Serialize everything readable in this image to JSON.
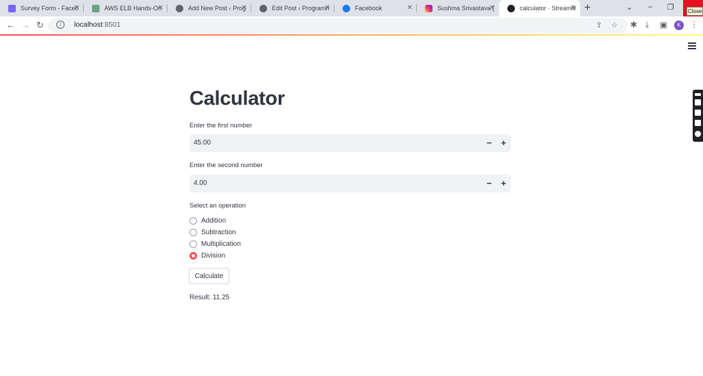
{
  "browser": {
    "tabs": [
      {
        "title": "Survey Form - Faceb",
        "favicon_color": "#7b61ff"
      },
      {
        "title": "AWS ELB Hands-On",
        "favicon_color": "#6aa38a"
      },
      {
        "title": "Add New Post ‹ Prog",
        "favicon_color": "#5f6368"
      },
      {
        "title": "Edit Post ‹ Programm",
        "favicon_color": "#5f6368"
      },
      {
        "title": "Facebook",
        "favicon_color": "#1877f2"
      },
      {
        "title": "Sushma Srivastava (",
        "favicon_color": "#e1306c"
      },
      {
        "title": "calculator · Streamlit",
        "favicon_color": "#202124"
      }
    ],
    "close_tooltip": "Close",
    "url_host": "localhost",
    "url_port": ":8501",
    "avatar_letter": "K"
  },
  "app": {
    "title": "Calculator",
    "first": {
      "label": "Enter the first number",
      "value": "45.00"
    },
    "second": {
      "label": "Enter the second number",
      "value": "4.00"
    },
    "operation_label": "Select an operation",
    "operations": [
      "Addition",
      "Subtraction",
      "Multiplication",
      "Division"
    ],
    "selected_operation": "Division",
    "calculate_label": "Calculate",
    "result_text": "Result: 11.25",
    "accent_color": "#ff4b4b"
  }
}
